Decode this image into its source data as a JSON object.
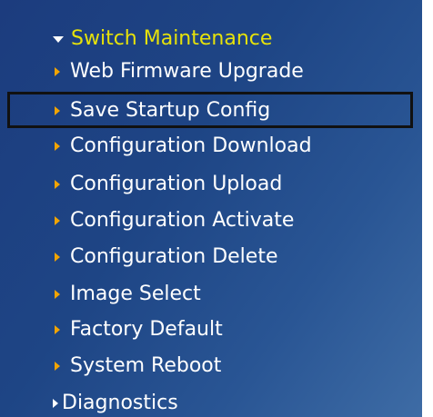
{
  "menu": {
    "section_label": "Switch Maintenance",
    "items": [
      {
        "label": "Web Firmware Upgrade"
      },
      {
        "label": "Save Startup Config"
      },
      {
        "label": "Configuration Download"
      },
      {
        "label": "Configuration Upload"
      },
      {
        "label": "Configuration Activate"
      },
      {
        "label": "Configuration Delete"
      },
      {
        "label": "Image Select"
      },
      {
        "label": "Factory Default"
      },
      {
        "label": "System Reboot"
      }
    ],
    "next_section_label": "Diagnostics"
  },
  "colors": {
    "section_label": "#e6e20a",
    "item_arrow": "#f2a400",
    "panel_background": "#1e4585",
    "highlight_border": "#111111"
  },
  "icons": {
    "section_toggle": "caret-down-icon",
    "item_bullet": "caret-right-icon"
  }
}
